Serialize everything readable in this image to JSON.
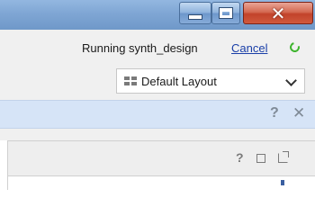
{
  "window_controls": {
    "minimize": "minimize-icon",
    "maximize": "maximize-icon",
    "close": "close-icon"
  },
  "status": {
    "text": "Running synth_design",
    "cancel_label": "Cancel",
    "spinner_color": "#3eb42e"
  },
  "layout_selector": {
    "icon": "layout-grid-icon",
    "value": "Default Layout"
  },
  "info_bar": {
    "help_glyph": "?",
    "close_glyph": "✕",
    "background": "#d6e4f7"
  },
  "panel_header": {
    "help_glyph": "?",
    "maximize_icon": "maximize-icon",
    "float_icon": "float-window-icon"
  }
}
